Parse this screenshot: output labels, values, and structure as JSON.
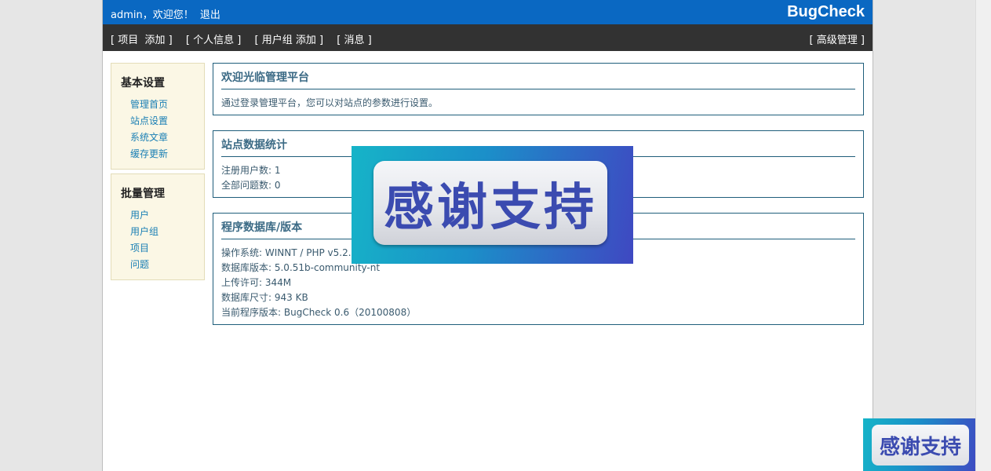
{
  "header": {
    "greeting": "admin，欢迎您！",
    "logout": "退出",
    "brand": "BugCheck"
  },
  "nav": {
    "project": "项目",
    "project_add": "添加",
    "profile": "个人信息",
    "usergroup": "用户组",
    "usergroup_add": "添加",
    "messages": "消息",
    "advanced": "高级管理"
  },
  "sidebar": {
    "basic": {
      "title": "基本设置",
      "items": [
        "管理首页",
        "站点设置",
        "系统文章",
        "缓存更新"
      ]
    },
    "batch": {
      "title": "批量管理",
      "items": [
        "用户",
        "用户组",
        "项目",
        "问题"
      ]
    }
  },
  "panels": {
    "welcome": {
      "title": "欢迎光临管理平台",
      "text": "通过登录管理平台，您可以对站点的参数进行设置。"
    },
    "stats": {
      "title": "站点数据统计",
      "lines": [
        "注册用户数: 1",
        "全部问题数: 0"
      ]
    },
    "version": {
      "title": "程序数据库/版本",
      "lines": [
        "操作系统: WINNT / PHP v5.2.6",
        "数据库版本: 5.0.51b-community-nt",
        "上传许可: 344M",
        "数据库尺寸: 943 KB",
        "当前程序版本: BugCheck 0.6（20100808）"
      ]
    }
  },
  "overlay": {
    "text": "感谢支持"
  }
}
